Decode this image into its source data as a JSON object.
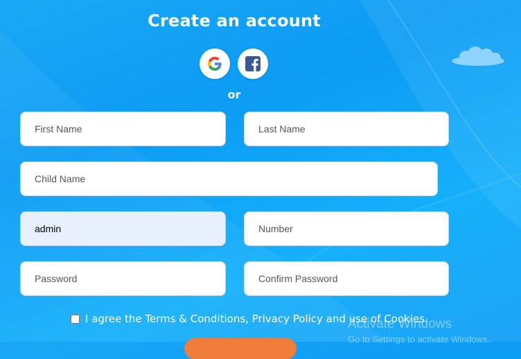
{
  "page": {
    "title": "Create an account",
    "divider": "or"
  },
  "social": [
    {
      "name": "google-login-button",
      "icon": "google-icon"
    },
    {
      "name": "facebook-login-button",
      "icon": "facebook-icon"
    }
  ],
  "form": {
    "first_name": {
      "placeholder": "First Name",
      "value": ""
    },
    "last_name": {
      "placeholder": "Last Name",
      "value": ""
    },
    "child_name": {
      "placeholder": "Child Name",
      "value": ""
    },
    "username": {
      "placeholder": "",
      "value": "admin"
    },
    "number": {
      "placeholder": "Number",
      "value": ""
    },
    "password": {
      "placeholder": "Password",
      "value": ""
    },
    "confirm_password": {
      "placeholder": "Confirm Password",
      "value": ""
    }
  },
  "terms": {
    "label": "I agree the Terms & Conditions, Privacy Policy and use of Cookies.",
    "checked": false
  },
  "watermark": {
    "title": "Activate Windows",
    "subtitle": "Go to Settings to activate Windows."
  },
  "colors": {
    "background": "#0c9cf4",
    "submit": "#f07e3a",
    "facebook": "#3b5998"
  }
}
